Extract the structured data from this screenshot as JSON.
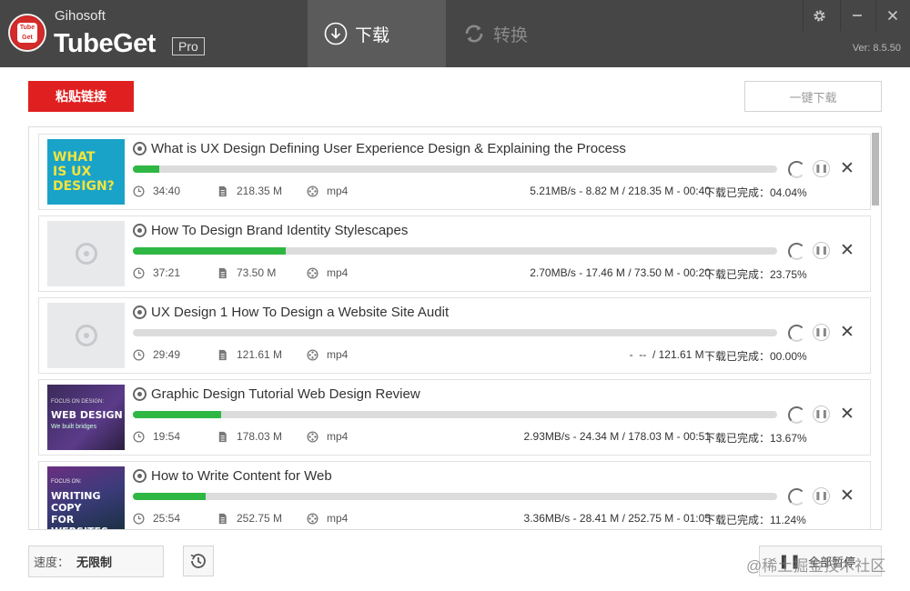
{
  "app": {
    "brand_small": "Gihosoft",
    "brand_big": "TubeGet",
    "edition": "Pro",
    "logo_text_top": "Tube",
    "logo_text_bottom": "Get",
    "version": "Ver: 8.5.50"
  },
  "tabs": [
    {
      "label": "下载",
      "icon": "download-circle-icon",
      "active": true
    },
    {
      "label": "转换",
      "icon": "convert-sync-icon",
      "active": false
    }
  ],
  "window_controls": [
    "gear-icon",
    "minimize-icon",
    "close-icon"
  ],
  "toolbar": {
    "paste_label": "粘贴链接",
    "download_all_label": "一键下载"
  },
  "downloads": [
    {
      "title": "What is UX Design Defining User Experience Design & Explaining the Process",
      "duration": "34:40",
      "size": "218.35 M",
      "format": "mp4",
      "speed_info": "5.21MB/s - 8.82 M / 218.35 M - 00:40",
      "status": "下载已完成：04.04%",
      "progress": 0.0404,
      "thumb_text": [
        "WHAT",
        "IS UX",
        "DESIGN?"
      ]
    },
    {
      "title": "How To Design Brand Identity Stylescapes",
      "duration": "37:21",
      "size": "73.50 M",
      "format": "mp4",
      "speed_info": "2.70MB/s - 17.46 M / 73.50 M - 00:20",
      "status": "下载已完成：23.75%",
      "progress": 0.2375
    },
    {
      "title": "UX Design 1 How To Design a Website Site Audit",
      "duration": "29:49",
      "size": "121.61 M",
      "format": "mp4",
      "speed_info": "-  --  / 121.61 M -",
      "status": "下载已完成：00.00%",
      "progress": 0.0
    },
    {
      "title": "Graphic Design Tutorial Web Design Review",
      "duration": "19:54",
      "size": "178.03 M",
      "format": "mp4",
      "speed_info": "2.93MB/s - 24.34 M / 178.03 M - 00:51",
      "status": "下载已完成：13.67%",
      "progress": 0.1367,
      "thumb_text": [
        "FOCUS ON DESIGN:",
        "WEB DESIGN",
        "We built bridges"
      ]
    },
    {
      "title": "How to Write Content for Web",
      "duration": "25:54",
      "size": "252.75 M",
      "format": "mp4",
      "speed_info": "3.36MB/s - 28.41 M / 252.75 M - 01:05",
      "status": "下载已完成：11.24%",
      "progress": 0.1124,
      "thumb_text": [
        "FOCUS ON:",
        "WRITING COPY",
        "FOR WEBSITES"
      ]
    }
  ],
  "footer": {
    "speed_label": "速度：",
    "speed_value": "无限制",
    "pause_all_label": "全部暂停",
    "watermark": "@稀土掘金技术社区"
  },
  "colors": {
    "header_bg": "#464646",
    "active_tab_bg": "#5b5b5b",
    "accent_red": "#e02020",
    "progress_green": "#2fb744"
  }
}
